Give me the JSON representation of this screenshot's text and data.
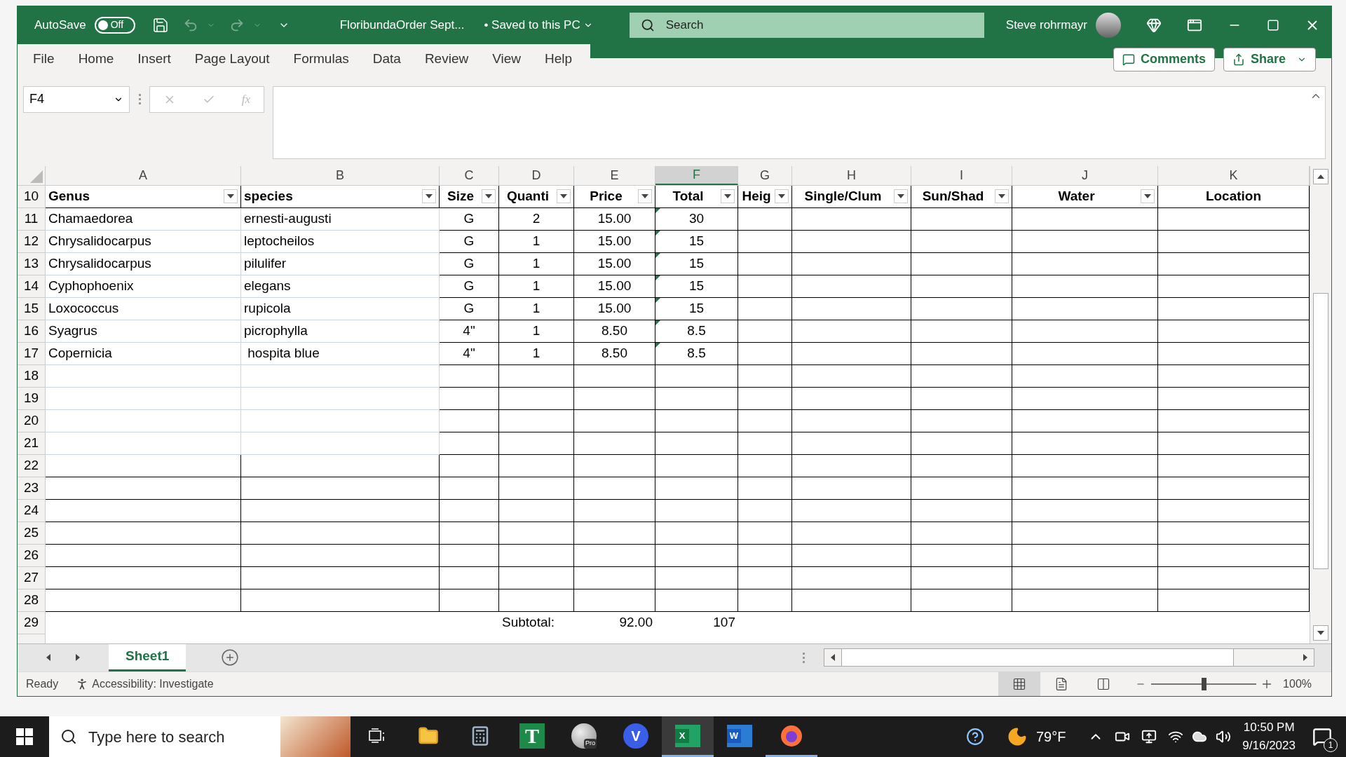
{
  "title_bar": {
    "autosave_label": "AutoSave",
    "autosave": {
      "on": false,
      "label": "Off"
    },
    "filename": "FloribundaOrder Sept...",
    "save_status": "• Saved to this PC",
    "search_placeholder": "Search",
    "user": "Steve rohrmayr"
  },
  "ribbon_tabs": [
    {
      "label": "File",
      "selected": false
    },
    {
      "label": "Home",
      "selected": false
    },
    {
      "label": "Insert",
      "selected": false
    },
    {
      "label": "Page Layout",
      "selected": false
    },
    {
      "label": "Formulas",
      "selected": false
    },
    {
      "label": "Data",
      "selected": false
    },
    {
      "label": "Review",
      "selected": false
    },
    {
      "label": "View",
      "selected": false
    },
    {
      "label": "Help",
      "selected": false
    }
  ],
  "comments_button": "Comments",
  "share_button": "Share",
  "formula_bar": {
    "name_box": "F4",
    "function_label": "fx"
  },
  "columns": [
    {
      "letter": "A",
      "selected": false,
      "header": "Genus",
      "filter": true
    },
    {
      "letter": "B",
      "selected": false,
      "header": "species",
      "filter": true
    },
    {
      "letter": "C",
      "selected": false,
      "header": "Size",
      "filter": true
    },
    {
      "letter": "D",
      "selected": false,
      "header": "Quanti",
      "filter": true
    },
    {
      "letter": "E",
      "selected": false,
      "header": "Price",
      "filter": true
    },
    {
      "letter": "F",
      "selected": true,
      "header": "Total",
      "filter": true
    },
    {
      "letter": "G",
      "selected": false,
      "header": "Heig",
      "filter": true
    },
    {
      "letter": "H",
      "selected": false,
      "header": "Single/Clum",
      "filter": true
    },
    {
      "letter": "I",
      "selected": false,
      "header": "Sun/Shad",
      "filter": true
    },
    {
      "letter": "J",
      "selected": false,
      "header": "Water",
      "filter": true
    },
    {
      "letter": "K",
      "selected": false,
      "header": "Location",
      "filter": false
    }
  ],
  "header_row_number": "10",
  "rows": [
    {
      "number": "11",
      "kind": "data",
      "cells": [
        "Chamaedorea",
        "ernesti-augusti",
        "G",
        "2",
        "15.00",
        "30"
      ],
      "total_flagged": true
    },
    {
      "number": "12",
      "kind": "data",
      "cells": [
        "Chrysalidocarpus",
        "leptocheilos",
        "G",
        "1",
        "15.00",
        "15"
      ],
      "total_flagged": true
    },
    {
      "number": "13",
      "kind": "data",
      "cells": [
        "Chrysalidocarpus",
        "pilulifer",
        "G",
        "1",
        "15.00",
        "15"
      ],
      "total_flagged": true
    },
    {
      "number": "14",
      "kind": "data",
      "cells": [
        "Cyphophoenix",
        "elegans",
        "G",
        "1",
        "15.00",
        "15"
      ],
      "total_flagged": true
    },
    {
      "number": "15",
      "kind": "data",
      "cells": [
        "Loxococcus",
        "rupicola",
        "G",
        "1",
        "15.00",
        "15"
      ],
      "total_flagged": true
    },
    {
      "number": "16",
      "kind": "data",
      "cells": [
        "Syagrus",
        "picrophylla",
        "4\"",
        "1",
        "8.50",
        "8.5"
      ],
      "total_flagged": true
    },
    {
      "number": "17",
      "kind": "data",
      "cells": [
        "Copernicia",
        " hospita blue",
        "4\"",
        "1",
        "8.50",
        "8.5"
      ],
      "total_flagged": true
    },
    {
      "number": "18",
      "kind": "empty"
    },
    {
      "number": "19",
      "kind": "empty"
    },
    {
      "number": "20",
      "kind": "empty"
    },
    {
      "number": "21",
      "kind": "empty"
    },
    {
      "number": "22",
      "kind": "boxed"
    },
    {
      "number": "23",
      "kind": "boxed"
    },
    {
      "number": "24",
      "kind": "boxed"
    },
    {
      "number": "25",
      "kind": "boxed"
    },
    {
      "number": "26",
      "kind": "boxed"
    },
    {
      "number": "27",
      "kind": "boxed"
    },
    {
      "number": "28",
      "kind": "boxed"
    },
    {
      "number": "29",
      "kind": "subtotal",
      "label": "Subtotal:",
      "price": "92.00",
      "total": "107"
    }
  ],
  "sheet_tabs": [
    {
      "label": "Sheet1",
      "selected": true
    }
  ],
  "status_bar": {
    "state": "Ready",
    "accessibility": "Accessibility: Investigate",
    "views": [
      {
        "kind": "normal",
        "selected": true
      },
      {
        "kind": "page-layout",
        "selected": false
      },
      {
        "kind": "page-break",
        "selected": false
      }
    ],
    "zoom": {
      "level": 0.5,
      "label": "100%"
    }
  },
  "taskbar": {
    "search_placeholder": "Type here to search",
    "apps": [
      {
        "kind": "task-view",
        "running": false,
        "focused": false
      },
      {
        "kind": "folder",
        "running": false,
        "focused": false
      },
      {
        "kind": "calculator",
        "running": false,
        "focused": false
      },
      {
        "kind": "letter-green",
        "glyph": "T",
        "running": false,
        "focused": false
      },
      {
        "kind": "globe",
        "glyph": "Pro",
        "running": false,
        "focused": false
      },
      {
        "kind": "letter-blue-circle",
        "glyph": "V",
        "running": false,
        "focused": false
      },
      {
        "kind": "sheet-app",
        "glyph": "X",
        "running": true,
        "focused": true
      },
      {
        "kind": "doc-app",
        "glyph": "W",
        "running": false,
        "focused": false
      },
      {
        "kind": "browser",
        "running": true,
        "focused": false
      }
    ],
    "temperature": "79°F",
    "time": "10:50 PM",
    "date": "9/16/2023",
    "notifications": "1"
  }
}
